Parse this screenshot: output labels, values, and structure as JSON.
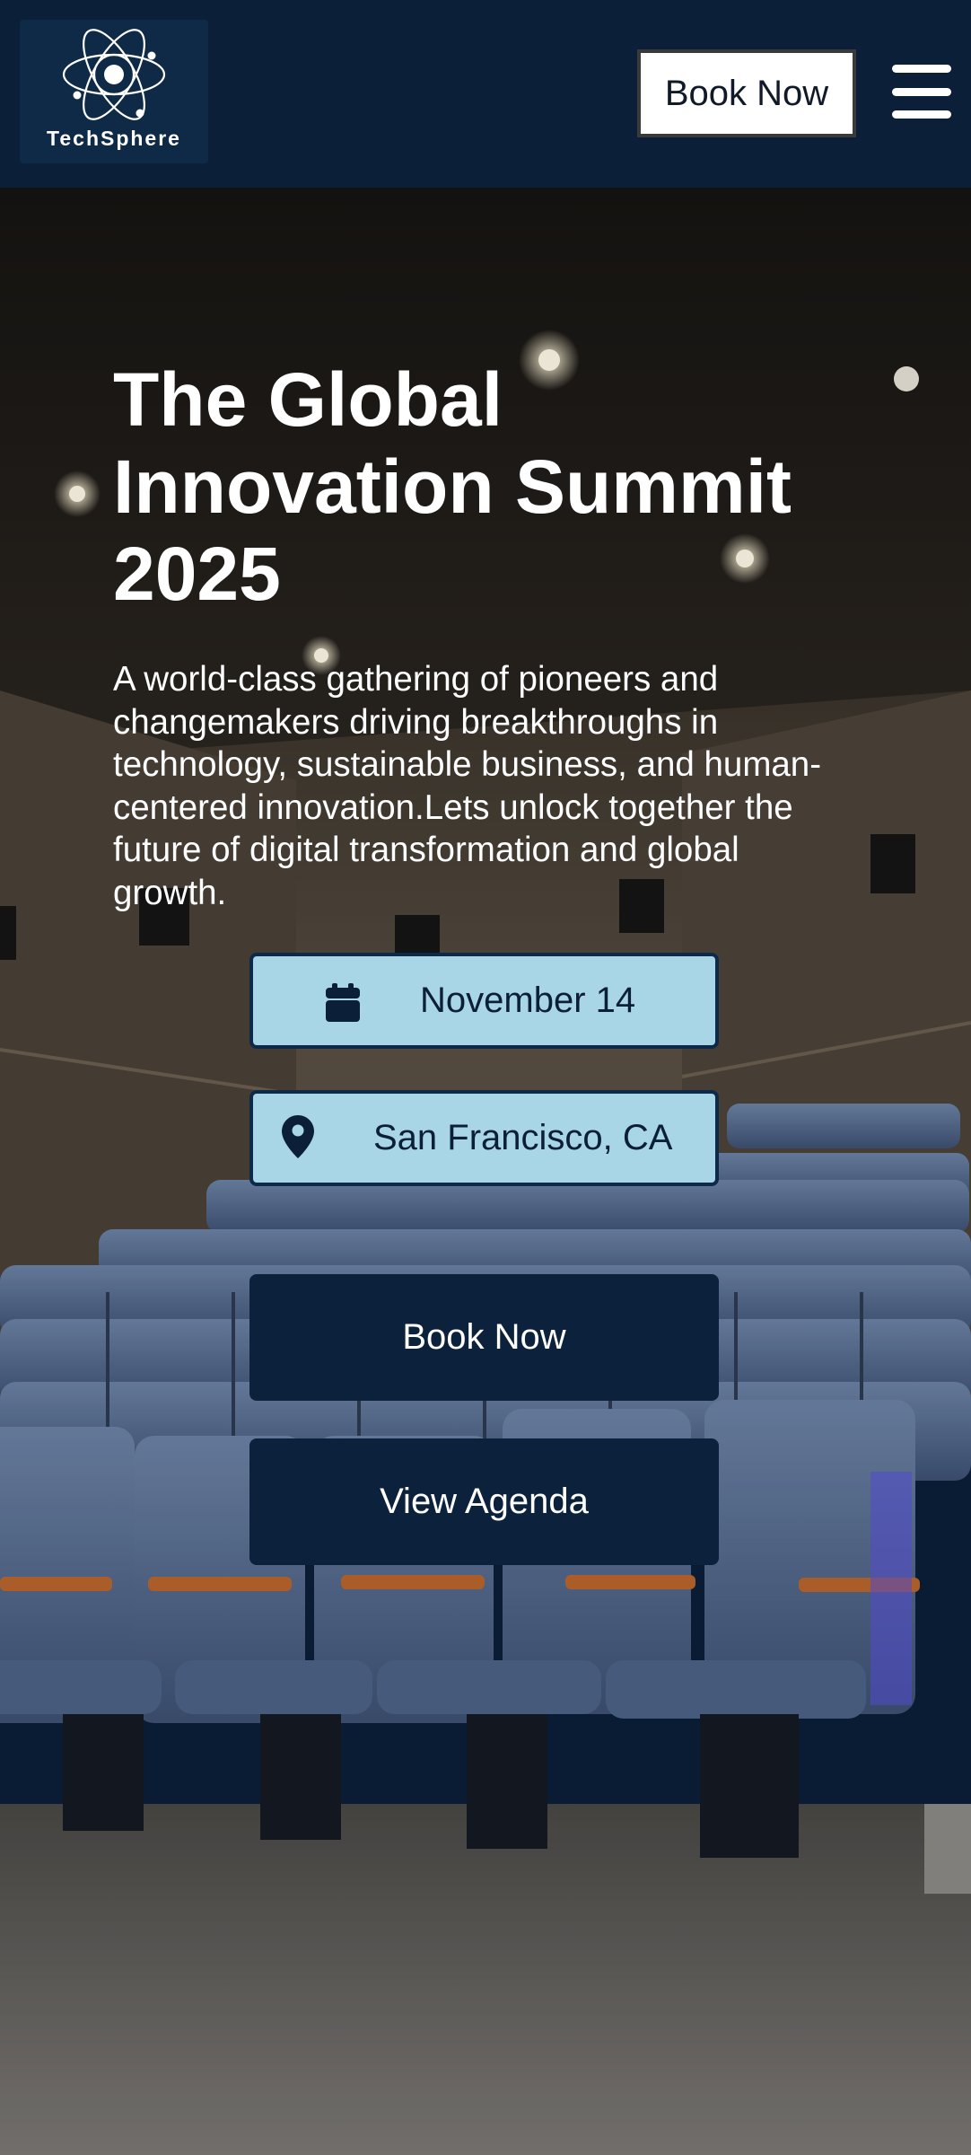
{
  "header": {
    "logo_text": "TechSphere",
    "book_label": "Book Now",
    "menu_icon": "hamburger-menu-icon"
  },
  "hero": {
    "title": "The Global Innovation Summit 2025",
    "description": "A world-class gathering of pioneers and changemakers driving breakthroughs in technology, sustainable business, and human-centered innovation.Lets unlock together the future of digital transformation and global growth.",
    "date": {
      "icon": "calendar-icon",
      "text": "November 14"
    },
    "location": {
      "icon": "location-pin-icon",
      "text": "San Francisco, CA"
    },
    "primary_cta": "Book Now",
    "secondary_cta": "View Agenda"
  },
  "colors": {
    "navy": "#0b1f38",
    "pill_blue": "#a8d6e6",
    "white": "#ffffff"
  }
}
